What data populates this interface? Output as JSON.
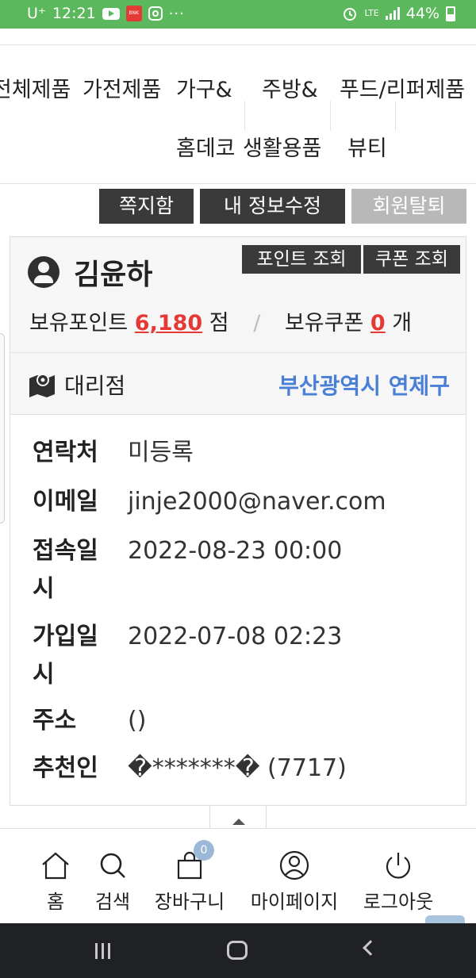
{
  "status_bar": {
    "carrier": "U⁺",
    "time": "12:21",
    "bnk_text": "BNK",
    "dots": "···",
    "network": "LTE",
    "battery": "44%"
  },
  "category_nav": {
    "items": [
      "전체제품",
      "가전제품",
      "가구&",
      "주방&",
      "푸드/리퍼제품",
      "홈데코",
      "생활용품",
      "뷰티"
    ]
  },
  "actions": {
    "messages": "쪽지함",
    "edit_profile": "내 정보수정",
    "withdraw": "회원탈퇴"
  },
  "profile": {
    "name": "김윤하",
    "point_lookup": "포인트 조회",
    "coupon_lookup": "쿠폰 조회",
    "points_label": "보유포인트",
    "points_value": "6,180",
    "points_unit": "점",
    "separator": "/",
    "coupons_label": "보유쿠폰",
    "coupons_value": "0",
    "coupons_unit": "개",
    "agency_label": "대리점",
    "agency_value": "부산광역시 연제구"
  },
  "info": {
    "rows": [
      {
        "key": "연락처",
        "value": "미등록"
      },
      {
        "key": "이메일",
        "value": "jinje2000@naver.com"
      },
      {
        "key": "접속일시",
        "value": "2022-08-23 00:00"
      },
      {
        "key": "가입일시",
        "value": "2022-07-08 02:23"
      },
      {
        "key": "주소",
        "value": "()"
      },
      {
        "key": "추천인",
        "value": "�*******� (7717)"
      }
    ]
  },
  "tabbar": {
    "home": "홈",
    "search": "검색",
    "cart": "장바구니",
    "cart_count": "0",
    "mypage": "마이페이지",
    "logout": "로그아웃"
  },
  "colors": {
    "status_bar": "#5cb85c",
    "accent_red": "#e53935",
    "accent_blue": "#4a7fd6",
    "dark_button": "#3a3a3a"
  }
}
